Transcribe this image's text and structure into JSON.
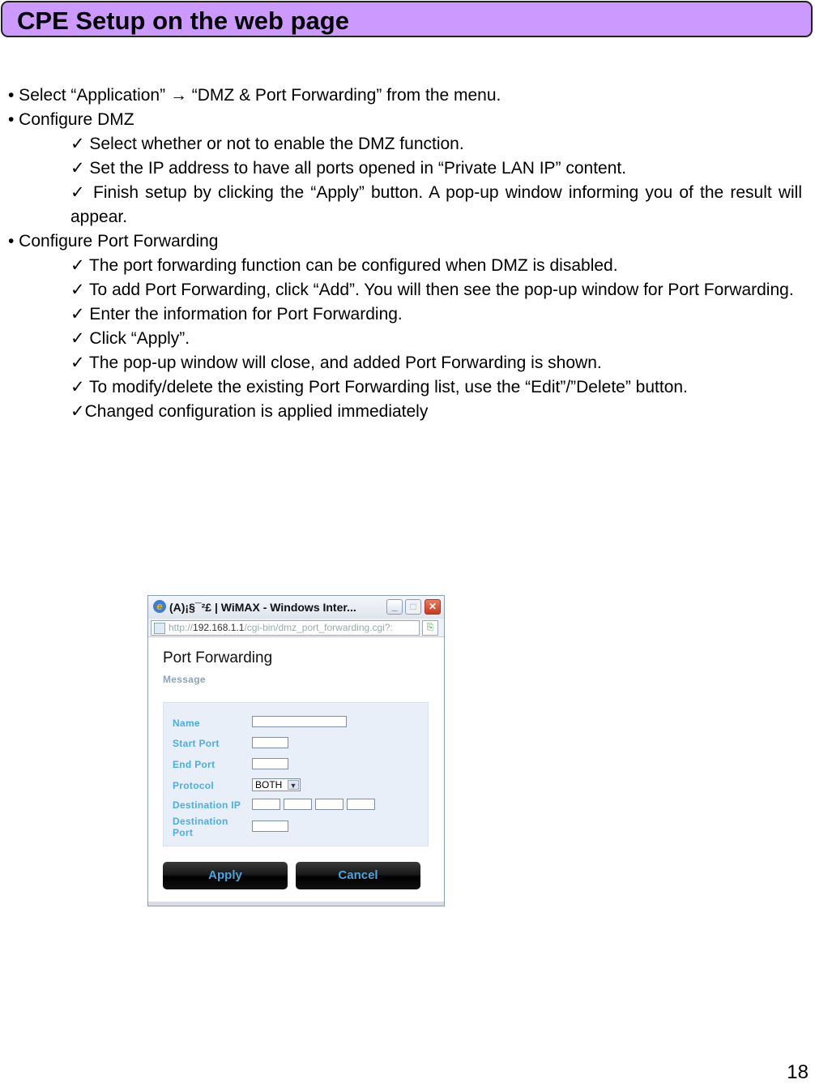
{
  "header": {
    "title": "CPE Setup on the web page"
  },
  "instructions": [
    {
      "type": "bullet",
      "text": "• Select “Application” → “DMZ & Port Forwarding” from the menu."
    },
    {
      "type": "bullet",
      "text": "• Configure  DMZ"
    },
    {
      "type": "check",
      "text": "✓ Select whether or not to enable the DMZ function."
    },
    {
      "type": "check",
      "text": "✓ Set the IP address to have all ports opened in “Private LAN IP” content."
    },
    {
      "type": "check",
      "text": "✓ Finish setup by clicking the “Apply” button. A pop-up window informing you of the result will appear."
    },
    {
      "type": "bullet",
      "text": "• Configure Port Forwarding"
    },
    {
      "type": "check",
      "text": "✓ The port forwarding function can be configured when DMZ is disabled."
    },
    {
      "type": "check",
      "text": "✓ To add Port Forwarding, click “Add”. You will then see the pop-up window for Port Forwarding."
    },
    {
      "type": "check",
      "text": "✓ Enter the information for Port Forwarding."
    },
    {
      "type": "check",
      "text": "✓ Click “Apply”."
    },
    {
      "type": "check",
      "text": "✓ The pop-up window will close, and added Port Forwarding is shown."
    },
    {
      "type": "check",
      "text": "✓ To modify/delete the existing Port Forwarding list, use the “Edit”/”Delete” button."
    },
    {
      "type": "check",
      "text": "✓Changed configuration is applied immediately"
    }
  ],
  "screenshot": {
    "window_title": "(A)¡§¯²£ | WiMAX - Windows Inter...",
    "address": {
      "prefix": "http://",
      "host": "192.168.1.1",
      "path": "/cgi-bin/dmz_port_forwarding.cgi?:"
    },
    "page_heading": "Port Forwarding",
    "message_label": "Message",
    "fields": {
      "name": "Name",
      "start_port": "Start Port",
      "end_port": "End Port",
      "protocol": "Protocol",
      "protocol_value": "BOTH",
      "destination_ip": "Destination IP",
      "destination_port_line1": "Destination",
      "destination_port_line2": "Port"
    },
    "buttons": {
      "apply": "Apply",
      "cancel": "Cancel"
    }
  },
  "page_number": "18"
}
